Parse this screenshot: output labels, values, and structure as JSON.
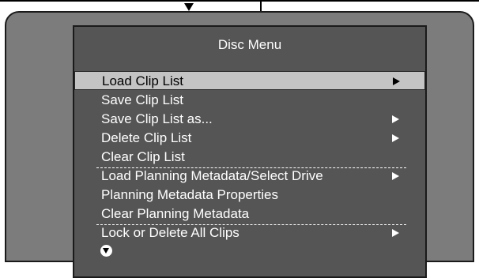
{
  "menu": {
    "title": "Disc Menu",
    "items": [
      {
        "label": "Load  Clip List",
        "has_submenu": true,
        "selected": true
      },
      {
        "label": "Save Clip List",
        "has_submenu": false
      },
      {
        "label": "Save Clip List as...",
        "has_submenu": true
      },
      {
        "label": "Delete Clip List",
        "has_submenu": true
      },
      {
        "label": "Clear Clip List",
        "has_submenu": false
      },
      {
        "label": "Load Planning Metadata/Select Drive",
        "has_submenu": true
      },
      {
        "label": "Planning Metadata Properties",
        "has_submenu": false
      },
      {
        "label": "Clear Planning Metadata",
        "has_submenu": false
      },
      {
        "label": "Lock or Delete All Clips",
        "has_submenu": true
      }
    ],
    "more_below_icon": "scroll-down-icon"
  },
  "colors": {
    "screen": "#7c7c7c",
    "panel": "#555555",
    "selection": "#c4c4c4",
    "text": "#ffffff"
  }
}
